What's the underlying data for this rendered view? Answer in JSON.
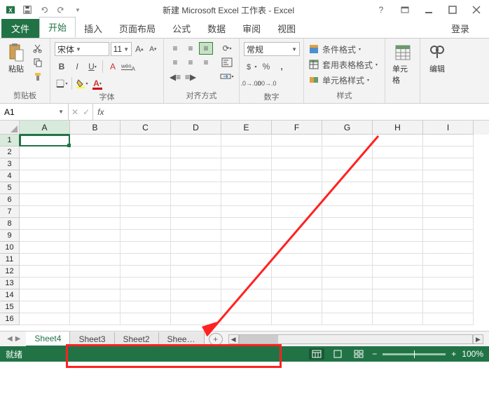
{
  "title": "新建 Microsoft Excel 工作表 - Excel",
  "ribbon": {
    "file_label": "文件",
    "tabs": [
      "开始",
      "插入",
      "页面布局",
      "公式",
      "数据",
      "审阅",
      "视图"
    ],
    "active_tab": "开始",
    "login": "登录"
  },
  "clipboard": {
    "paste_label": "粘贴",
    "group_label": "剪贴板"
  },
  "font": {
    "name": "宋体",
    "size": "11",
    "group_label": "字体"
  },
  "alignment": {
    "group_label": "对齐方式"
  },
  "number": {
    "format": "常规",
    "group_label": "数字"
  },
  "styles": {
    "cond_format": "条件格式",
    "table_format": "套用表格格式",
    "cell_styles": "单元格样式",
    "group_label": "样式"
  },
  "cells_group": {
    "label": "单元格"
  },
  "editing_group": {
    "label": "编辑"
  },
  "namebox": "A1",
  "fx_label": "fx",
  "columns": [
    "A",
    "B",
    "C",
    "D",
    "E",
    "F",
    "G",
    "H",
    "I"
  ],
  "row_count": 16,
  "sheet_tabs": [
    "Sheet4",
    "Sheet3",
    "Sheet2",
    "Shee…"
  ],
  "active_sheet": "Sheet4",
  "status": {
    "ready": "就绪",
    "zoom": "100%"
  }
}
